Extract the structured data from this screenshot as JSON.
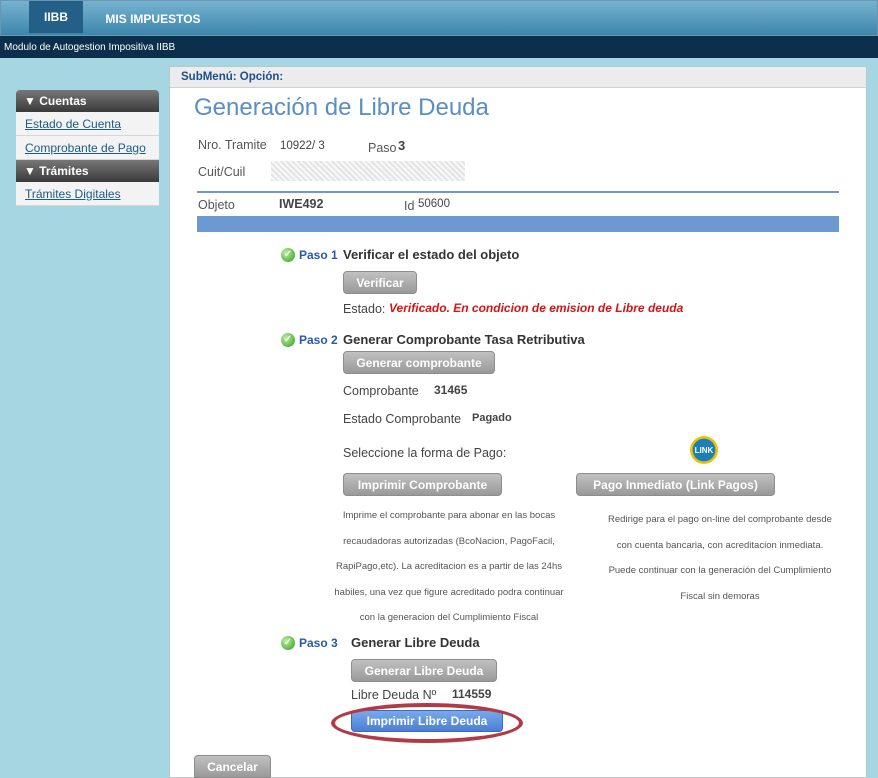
{
  "header": {
    "tab_iibb": "IIBB",
    "tab_mis": "MIS IMPUESTOS",
    "subtitle": "Modulo de Autogestion Impositiva IIBB"
  },
  "sidebar": {
    "sections": [
      {
        "title": "▼ Cuentas",
        "items": [
          "Estado de Cuenta",
          "Comprobante de Pago"
        ]
      },
      {
        "title": "▼ Trámites",
        "items": [
          "Trámites Digitales"
        ]
      }
    ]
  },
  "main": {
    "submenu": "SubMenú: Opción:",
    "title": "Generación de Libre Deuda",
    "nro_tramite_label": "Nro. Tramite",
    "nro_tramite_value": "10922/ 3",
    "paso_label": "Paso",
    "paso_value": "3",
    "cuit_label": "Cuit/Cuil",
    "objeto_label": "Objeto",
    "objeto_value": "IWE492",
    "id_label": "Id",
    "id_value": "50600"
  },
  "step1": {
    "paso": "Paso 1",
    "title": "Verificar el estado del objeto",
    "button": "Verificar",
    "estado_label": "Estado:",
    "estado_value": "Verificado. En condicion de emision de Libre deuda"
  },
  "step2": {
    "paso": "Paso 2",
    "title": "Generar Comprobante Tasa Retributiva",
    "button": "Generar comprobante",
    "comprobante_label": "Comprobante",
    "comprobante_value": "31465",
    "estado_label": "Estado Comprobante",
    "estado_value": "Pagado",
    "forma_pago": "Seleccione la forma de Pago:",
    "link_logo": "LINK",
    "btn_imprimir": "Imprimir Comprobante",
    "btn_pago": "Pago Inmediato (Link Pagos)",
    "desc_imprimir": [
      "Imprime el comprobante para abonar en las bocas",
      "recaudadoras autorizadas (BcoNacion, PagoFacil,",
      "RapiPago,etc). La acreditacion es a partir de las 24hs",
      "habiles, una vez que figure acreditado podra continuar",
      "con la generacion del Cumplimiento Fiscal"
    ],
    "desc_pago": [
      "Redirige para el pago on-line del comprobante desde",
      "con cuenta bancaria, con acreditacion inmediata.",
      "Puede continuar con la generación del Cumplimiento",
      "Fiscal sin demoras"
    ]
  },
  "step3": {
    "paso": "Paso 3",
    "title": "Generar Libre Deuda",
    "button": "Generar Libre Deuda",
    "libre_label": "Libre Deuda Nº",
    "libre_value": "114559",
    "btn_imprimir": "Imprimir Libre Deuda"
  },
  "footer": {
    "cancel": "Cancelar"
  },
  "colors": {
    "accent": "#6c9ad0",
    "highlight": "#b23a46"
  }
}
